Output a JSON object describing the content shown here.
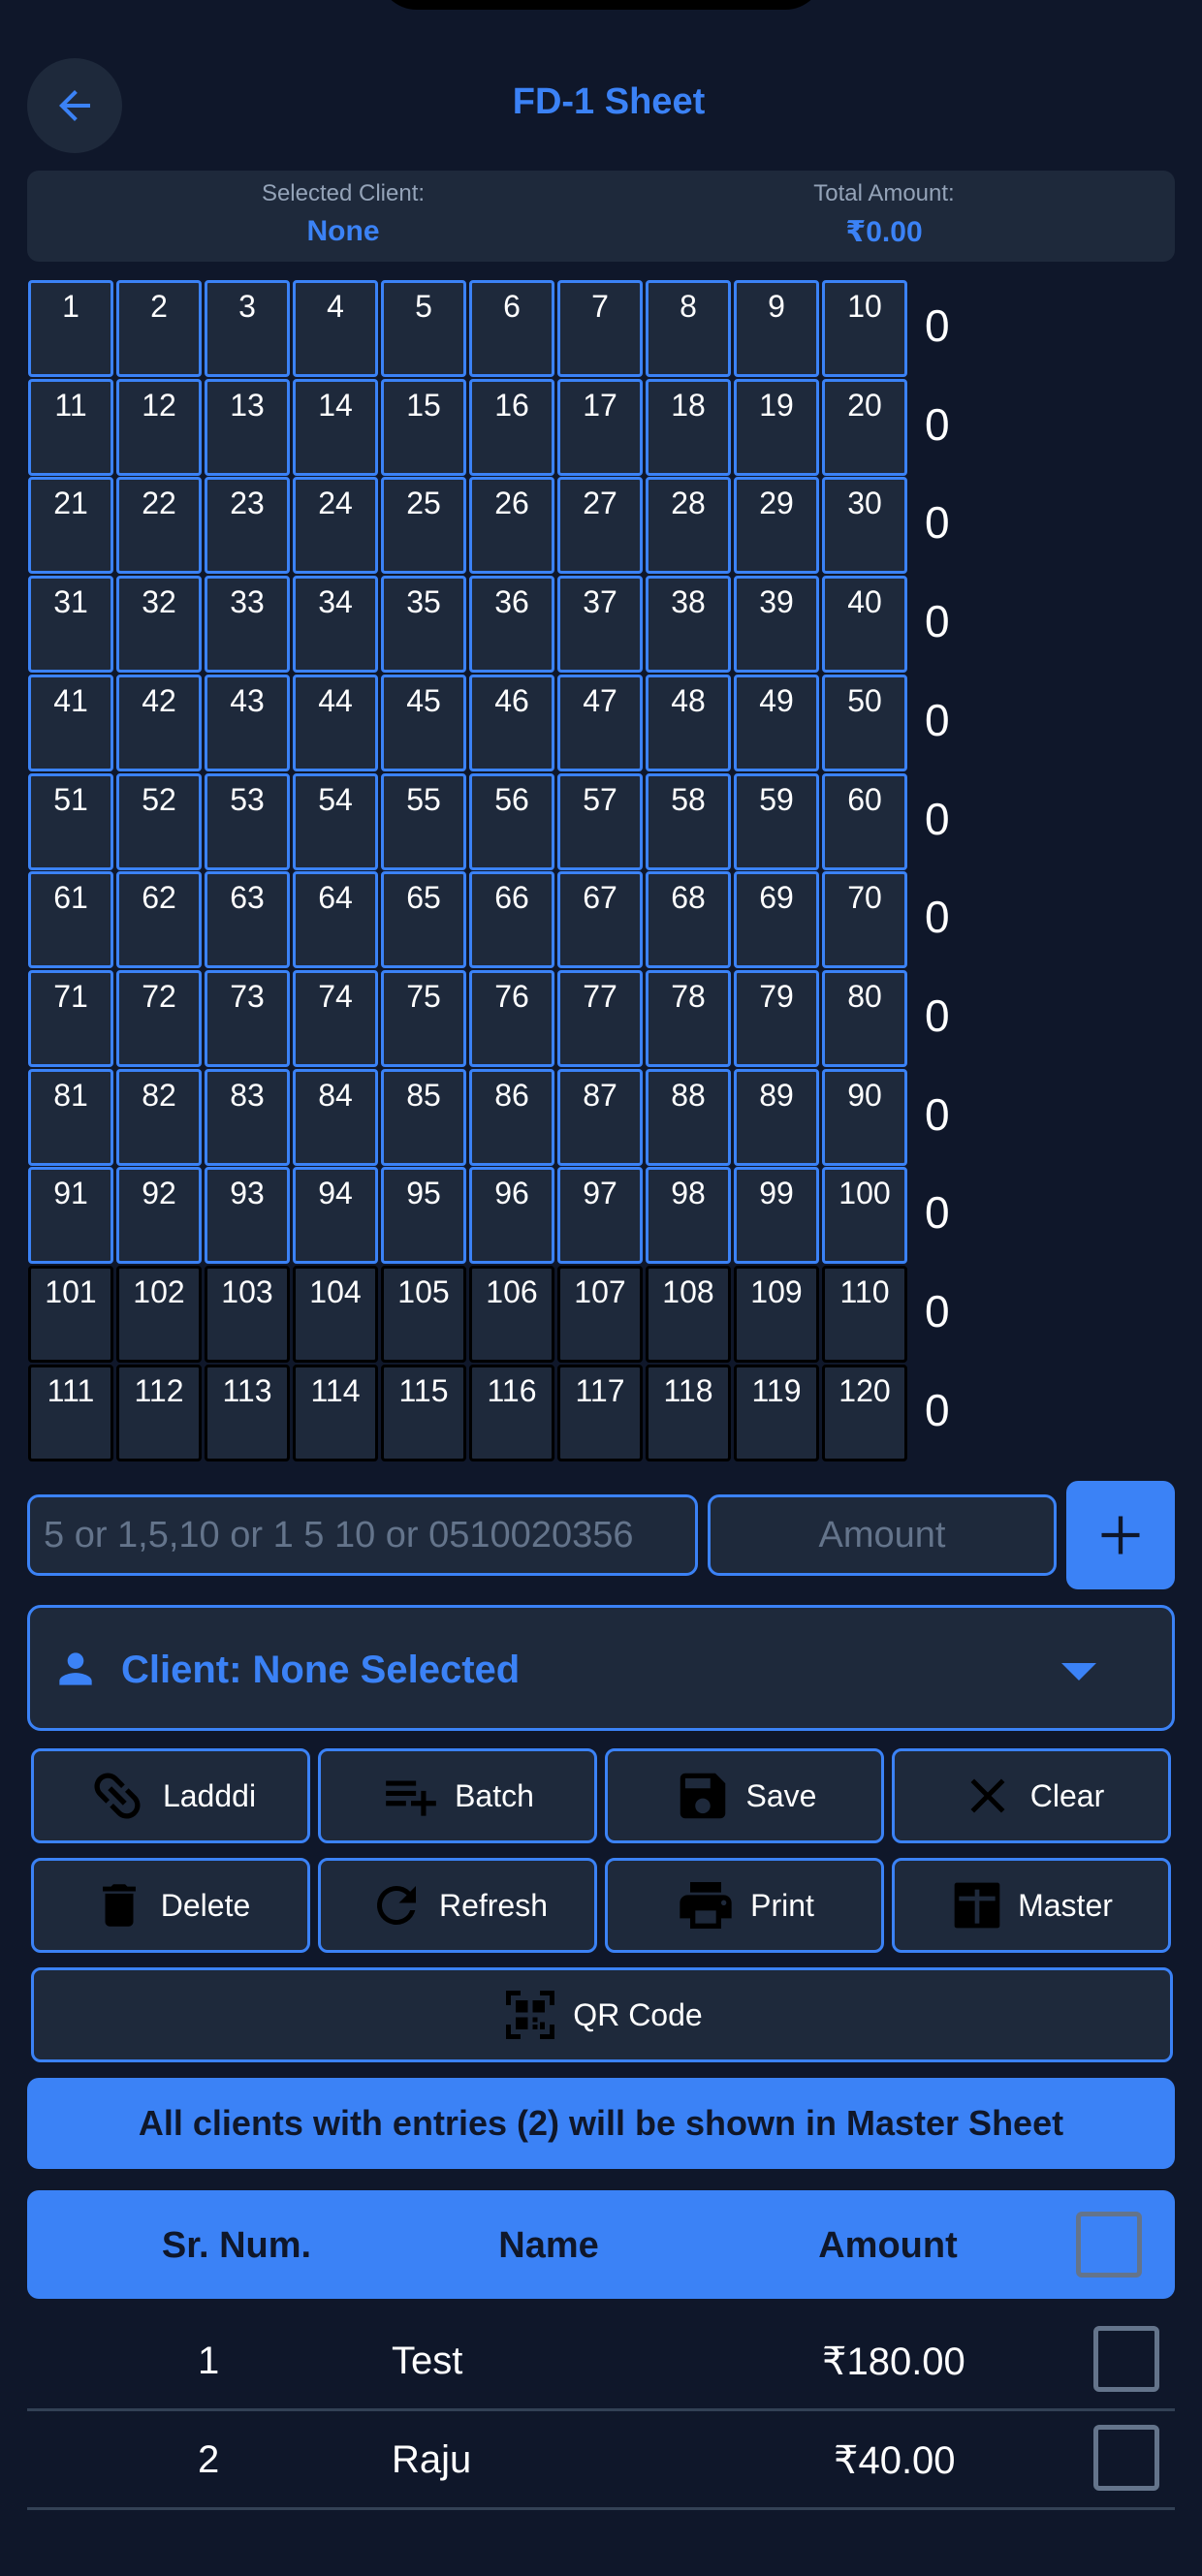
{
  "header": {
    "title": "FD-1 Sheet",
    "back_icon": "arrow-left-icon"
  },
  "summary": {
    "client_label": "Selected Client:",
    "client_value": "None",
    "amount_label": "Total Amount:",
    "amount_value": "₹0.00"
  },
  "grid": {
    "numbers": [
      [
        "1",
        "2",
        "3",
        "4",
        "5",
        "6",
        "7",
        "8",
        "9",
        "10"
      ],
      [
        "11",
        "12",
        "13",
        "14",
        "15",
        "16",
        "17",
        "18",
        "19",
        "20"
      ],
      [
        "21",
        "22",
        "23",
        "24",
        "25",
        "26",
        "27",
        "28",
        "29",
        "30"
      ],
      [
        "31",
        "32",
        "33",
        "34",
        "35",
        "36",
        "37",
        "38",
        "39",
        "40"
      ],
      [
        "41",
        "42",
        "43",
        "44",
        "45",
        "46",
        "47",
        "48",
        "49",
        "50"
      ],
      [
        "51",
        "52",
        "53",
        "54",
        "55",
        "56",
        "57",
        "58",
        "59",
        "60"
      ],
      [
        "61",
        "62",
        "63",
        "64",
        "65",
        "66",
        "67",
        "68",
        "69",
        "70"
      ],
      [
        "71",
        "72",
        "73",
        "74",
        "75",
        "76",
        "77",
        "78",
        "79",
        "80"
      ],
      [
        "81",
        "82",
        "83",
        "84",
        "85",
        "86",
        "87",
        "88",
        "89",
        "90"
      ],
      [
        "91",
        "92",
        "93",
        "94",
        "95",
        "96",
        "97",
        "98",
        "99",
        "100"
      ],
      [
        "101",
        "102",
        "103",
        "104",
        "105",
        "106",
        "107",
        "108",
        "109",
        "110"
      ],
      [
        "111",
        "112",
        "113",
        "114",
        "115",
        "116",
        "117",
        "118",
        "119",
        "120"
      ]
    ],
    "row_totals": [
      "0",
      "0",
      "0",
      "0",
      "0",
      "0",
      "0",
      "0",
      "0",
      "0",
      "0",
      "0"
    ],
    "accent_color": "#3b82f6",
    "inactive_border_color": "#000000"
  },
  "entry": {
    "numbers_placeholder": "5 or 1,5,10 or 1 5 10 or 0510020356",
    "amount_placeholder": "Amount",
    "add_icon": "plus-icon"
  },
  "client_select": {
    "label": "Client: None Selected",
    "icon": "person-icon",
    "caret_icon": "caret-down-icon"
  },
  "actions": {
    "ladddi": "Ladddi",
    "batch": "Batch",
    "save": "Save",
    "clear": "Clear",
    "delete": "Delete",
    "refresh": "Refresh",
    "print": "Print",
    "master": "Master",
    "qr_code": "QR Code"
  },
  "banner": "All clients with entries (2) will be shown in Master Sheet",
  "table": {
    "headers": {
      "sr": "Sr. Num.",
      "name": "Name",
      "amount": "Amount"
    },
    "rows": [
      {
        "sr": "1",
        "name": "Test",
        "amount": "₹180.00"
      },
      {
        "sr": "2",
        "name": "Raju",
        "amount": "₹40.00"
      }
    ]
  },
  "colors": {
    "background": "#0f172a",
    "surface": "#1e293b",
    "accent": "#3b82f6"
  }
}
